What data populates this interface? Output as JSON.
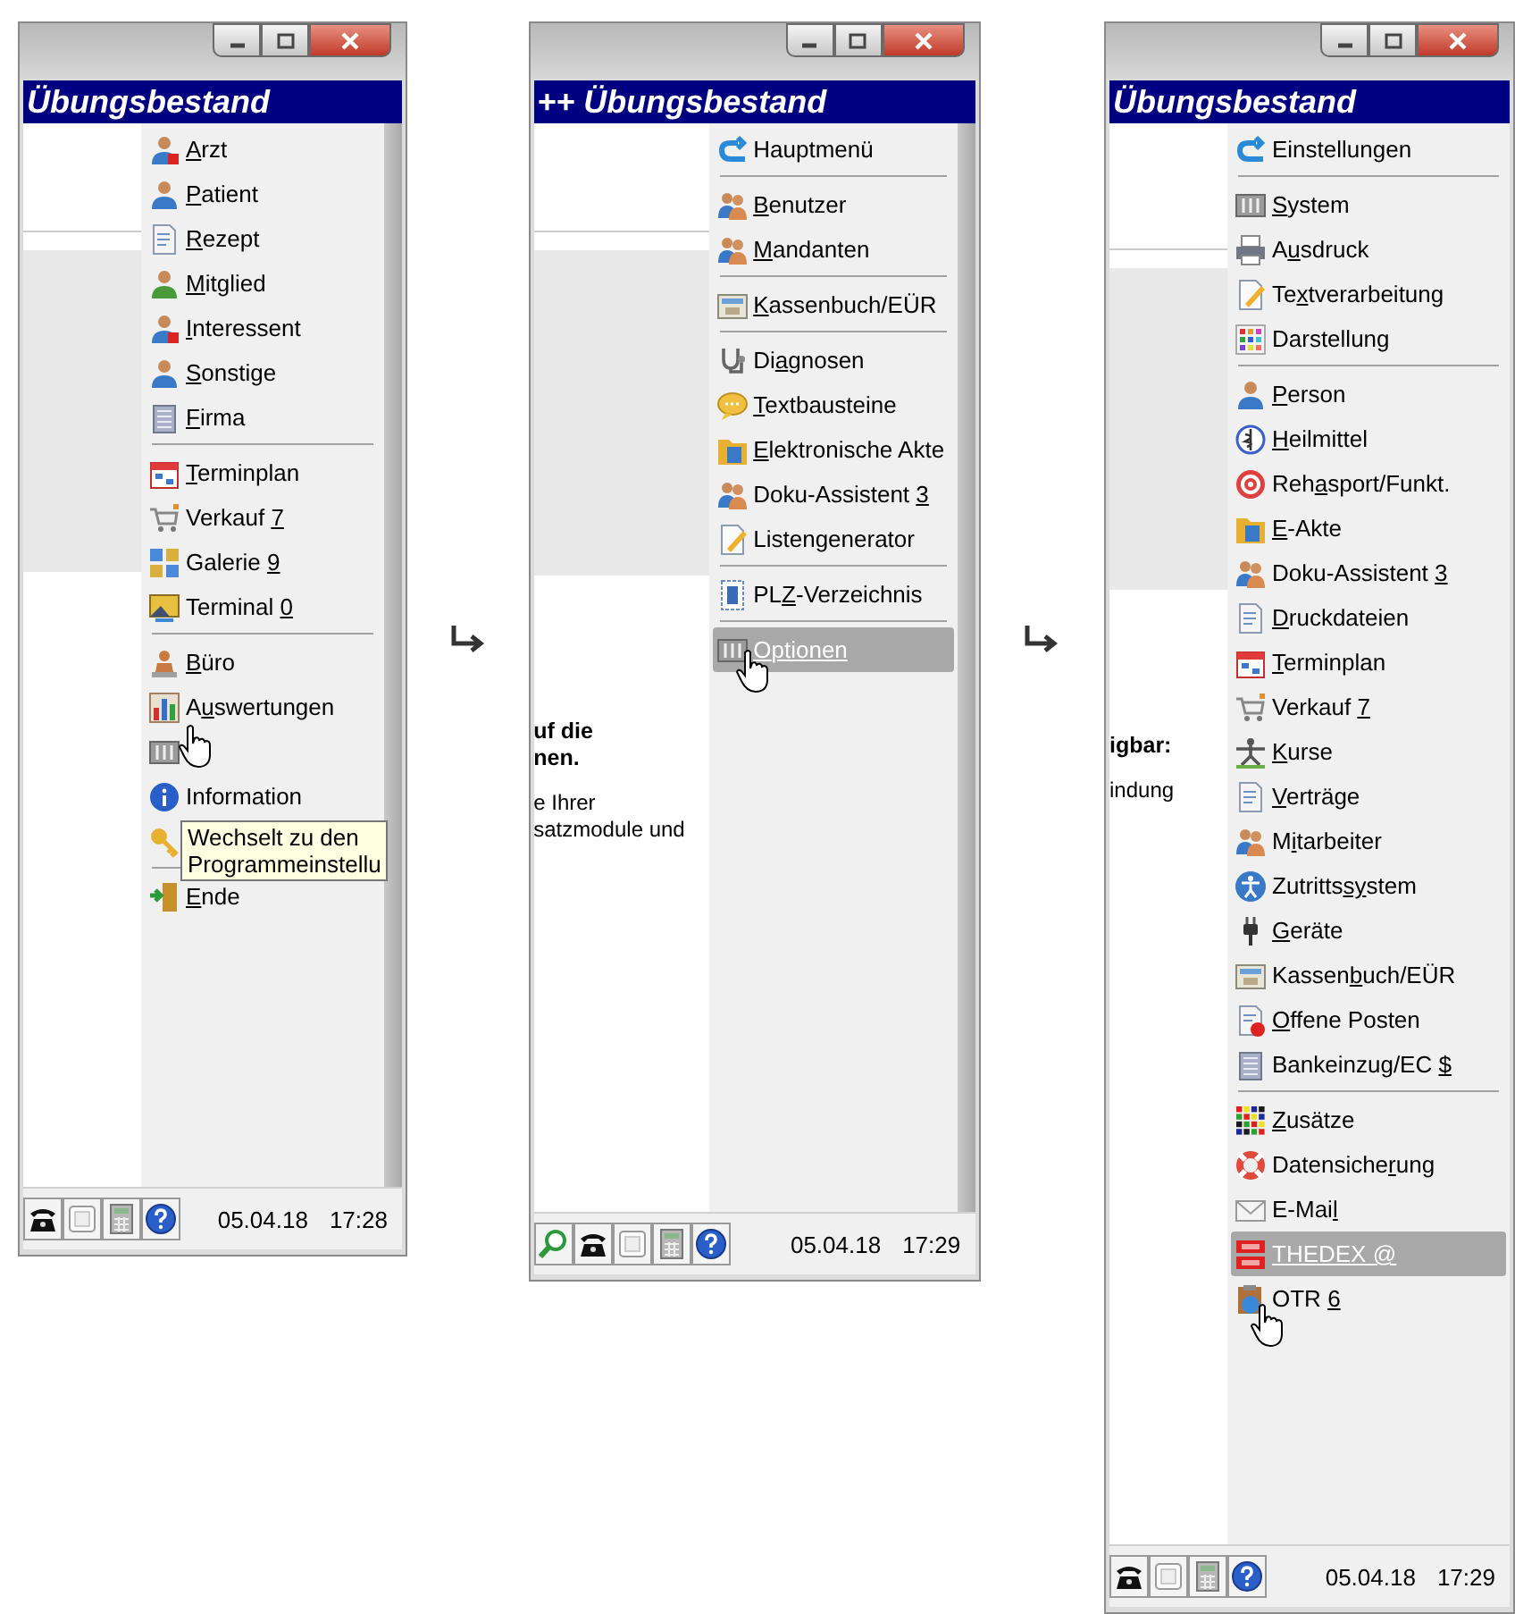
{
  "panels": [
    {
      "title": "Übungsbestand",
      "menu": [
        {
          "kind": "item",
          "key": "A",
          "post": "rzt",
          "selected": false
        },
        {
          "kind": "item",
          "key": "P",
          "post": "atient",
          "selected": false
        },
        {
          "kind": "item",
          "key": "R",
          "post": "ezept",
          "selected": false
        },
        {
          "kind": "item",
          "key": "M",
          "post": "itglied",
          "selected": false
        },
        {
          "kind": "item",
          "key": "I",
          "post": "nteressent",
          "selected": false
        },
        {
          "kind": "item",
          "key": "S",
          "post": "onstige",
          "selected": false
        },
        {
          "kind": "item",
          "key": "F",
          "post": "irma",
          "selected": false
        },
        {
          "kind": "separator"
        },
        {
          "kind": "item",
          "key": "T",
          "post": "erminplan",
          "selected": false
        },
        {
          "kind": "item",
          "pre": "Verkauf ",
          "key": "7",
          "selected": false
        },
        {
          "kind": "item",
          "pre": "Galerie ",
          "key": "9",
          "selected": false
        },
        {
          "kind": "item",
          "pre": "Terminal ",
          "key": "0",
          "selected": false
        },
        {
          "kind": "separator"
        },
        {
          "kind": "item",
          "key": "B",
          "post": "üro",
          "selected": false
        },
        {
          "kind": "item",
          "pre": "A",
          "key": "u",
          "post": "swertungen",
          "selected": false
        },
        {
          "kind": "icon_only",
          "selected": false
        },
        {
          "kind": "item",
          "label": "Information",
          "selected": false
        },
        {
          "kind": "icon_only",
          "selected": false
        },
        {
          "kind": "separator"
        },
        {
          "kind": "item",
          "key": "E",
          "post": "nde",
          "selected": false
        }
      ],
      "tooltip": "Wechselt zu den\nProgrammeinstellu",
      "status_bar": {
        "date": "05.04.18",
        "time": "17:28"
      }
    },
    {
      "title": "++ Übungsbestand",
      "menu": [
        {
          "kind": "item",
          "label": "Hauptmenü",
          "selected": false
        },
        {
          "kind": "separator"
        },
        {
          "kind": "item",
          "key": "B",
          "post": "enutzer",
          "selected": false
        },
        {
          "kind": "item",
          "key": "M",
          "post": "andanten",
          "selected": false
        },
        {
          "kind": "separator"
        },
        {
          "kind": "item",
          "key": "K",
          "post": "assenbuch/EÜR",
          "selected": false
        },
        {
          "kind": "separator"
        },
        {
          "kind": "item",
          "pre": "Di",
          "key": "a",
          "post": "gnosen",
          "selected": false
        },
        {
          "kind": "item",
          "key": "T",
          "post": "extbausteine",
          "selected": false
        },
        {
          "kind": "item",
          "key": "E",
          "post": "lektronische Akte",
          "selected": false
        },
        {
          "kind": "item",
          "pre": "Doku-Assistent ",
          "key": "3",
          "selected": false
        },
        {
          "kind": "item",
          "label": "Listengenerator",
          "selected": false
        },
        {
          "kind": "separator"
        },
        {
          "kind": "item",
          "pre": "PL",
          "key": "Z",
          "post": "-Verzeichnis",
          "selected": false
        },
        {
          "kind": "separator"
        },
        {
          "kind": "item",
          "key": "O",
          "post": "ptionen",
          "selected": true
        }
      ],
      "content_text": [
        {
          "text": "uf die\nnen.",
          "bold": true
        },
        {
          "text": "e Ihrer\nsatzmodule und",
          "bold": false
        }
      ],
      "status_bar": {
        "date": "05.04.18",
        "time": "17:29"
      }
    },
    {
      "title": "Übungsbestand",
      "menu": [
        {
          "kind": "item",
          "label": "Einstellungen",
          "selected": false
        },
        {
          "kind": "separator"
        },
        {
          "kind": "item",
          "key": "S",
          "post": "ystem",
          "selected": false
        },
        {
          "kind": "item",
          "pre": "A",
          "key": "u",
          "post": "sdruck",
          "selected": false
        },
        {
          "kind": "item",
          "pre": "Te",
          "key": "x",
          "post": "tverarbeitung",
          "selected": false
        },
        {
          "kind": "item",
          "pre": "Darstellun",
          "key": "g",
          "selected": false
        },
        {
          "kind": "separator"
        },
        {
          "kind": "item",
          "key": "P",
          "post": "erson",
          "selected": false
        },
        {
          "kind": "item",
          "key": "H",
          "post": "eilmittel",
          "selected": false
        },
        {
          "kind": "item",
          "pre": "Reh",
          "key": "a",
          "post": "sport/Funkt.",
          "selected": false
        },
        {
          "kind": "item",
          "key": "E",
          "post": "-Akte",
          "selected": false
        },
        {
          "kind": "item",
          "pre": "Doku-Assistent ",
          "key": "3",
          "selected": false
        },
        {
          "kind": "item",
          "key": "D",
          "post": "ruckdateien",
          "selected": false
        },
        {
          "kind": "item",
          "key": "T",
          "post": "erminplan",
          "selected": false
        },
        {
          "kind": "item",
          "pre": "Verkauf ",
          "key": "7",
          "selected": false
        },
        {
          "kind": "item",
          "key": "K",
          "post": "urse",
          "selected": false
        },
        {
          "kind": "item",
          "key": "V",
          "post": "erträge",
          "selected": false
        },
        {
          "kind": "item",
          "pre": "M",
          "key": "i",
          "post": "tarbeiter",
          "selected": false
        },
        {
          "kind": "item",
          "pre": "Zutritts",
          "key": "sy",
          "post": "stem",
          "selected": false
        },
        {
          "kind": "item",
          "key": "G",
          "post": "eräte",
          "selected": false
        },
        {
          "kind": "item",
          "pre": "Kassen",
          "key": "b",
          "post": "uch/EÜR",
          "selected": false
        },
        {
          "kind": "item",
          "key": "O",
          "post": "ffene Posten",
          "selected": false
        },
        {
          "kind": "item",
          "pre": "Bankeinzug/EC ",
          "key": "$",
          "selected": false
        },
        {
          "kind": "separator"
        },
        {
          "kind": "item",
          "key": "Z",
          "post": "usätze",
          "selected": false
        },
        {
          "kind": "item",
          "pre": "Datensiche",
          "key": "r",
          "post": "ung",
          "selected": false
        },
        {
          "kind": "item",
          "pre": "E-Mai",
          "key": "l",
          "selected": false
        },
        {
          "kind": "item",
          "pre": "THEDEX ",
          "key": "@",
          "selected": true
        },
        {
          "kind": "item",
          "pre": "OTR ",
          "key": "6",
          "selected": false
        }
      ],
      "content_text": [
        {
          "text": "igbar:",
          "bold": true
        },
        {
          "text": "indung",
          "bold": false
        }
      ],
      "status_bar": {
        "date": "05.04.18",
        "time": "17:29"
      }
    }
  ]
}
